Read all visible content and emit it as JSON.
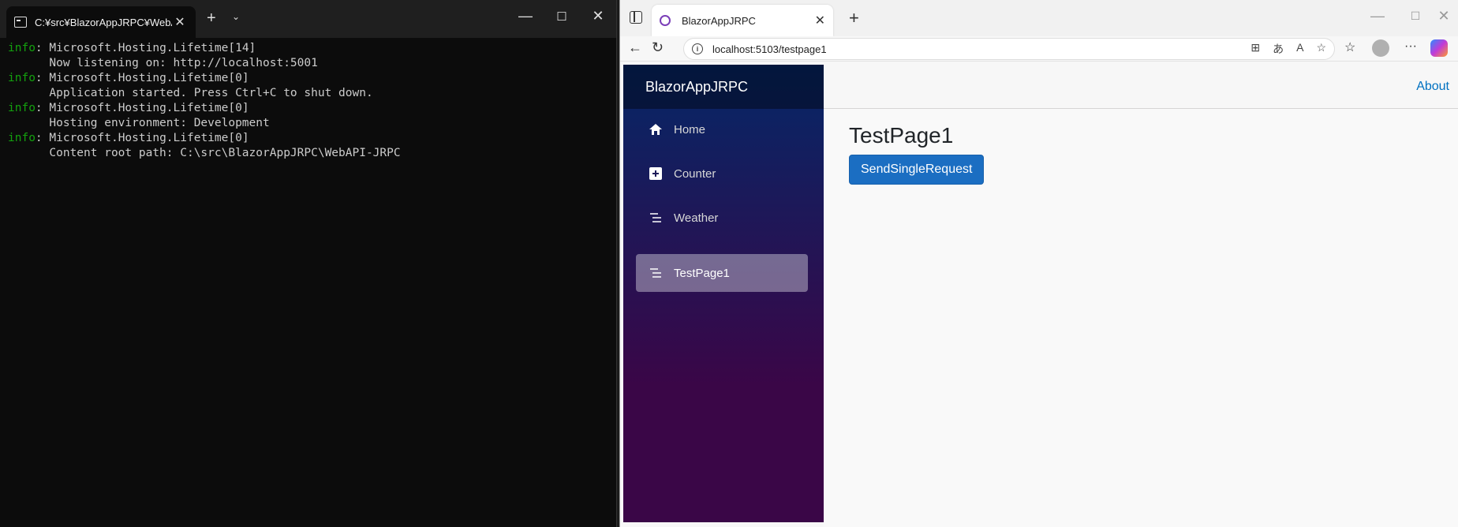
{
  "terminal": {
    "tab_title": "C:¥src¥BlazorAppJRPC¥WebAI",
    "lines": [
      {
        "level": "info",
        "text": "Microsoft.Hosting.Lifetime[14]"
      },
      {
        "level": "",
        "text": "      Now listening on: http://localhost:5001"
      },
      {
        "level": "info",
        "text": "Microsoft.Hosting.Lifetime[0]"
      },
      {
        "level": "",
        "text": "      Application started. Press Ctrl+C to shut down."
      },
      {
        "level": "info",
        "text": "Microsoft.Hosting.Lifetime[0]"
      },
      {
        "level": "",
        "text": "      Hosting environment: Development"
      },
      {
        "level": "info",
        "text": "Microsoft.Hosting.Lifetime[0]"
      },
      {
        "level": "",
        "text": "      Content root path: C:\\src\\BlazorAppJRPC\\WebAPI-JRPC"
      }
    ]
  },
  "browser": {
    "tab_title": "BlazorAppJRPC",
    "url": "localhost:5103/testpage1"
  },
  "app": {
    "brand": "BlazorAppJRPC",
    "about_link": "About",
    "nav": [
      {
        "label": "Home",
        "icon": "home-icon",
        "active": false
      },
      {
        "label": "Counter",
        "icon": "plus-square-icon",
        "active": false
      },
      {
        "label": "Weather",
        "icon": "list-icon",
        "active": false
      },
      {
        "label": "TestPage1",
        "icon": "list-icon",
        "active": true
      }
    ],
    "page_title": "TestPage1",
    "button_label": "SendSingleRequest"
  },
  "colors": {
    "terminal_bg": "#0c0c0c",
    "info_green": "#13a10e",
    "sidebar_top": "#052767",
    "sidebar_bottom": "#3a0647",
    "button_blue": "#1b6ec2",
    "link_blue": "#0071c1"
  }
}
